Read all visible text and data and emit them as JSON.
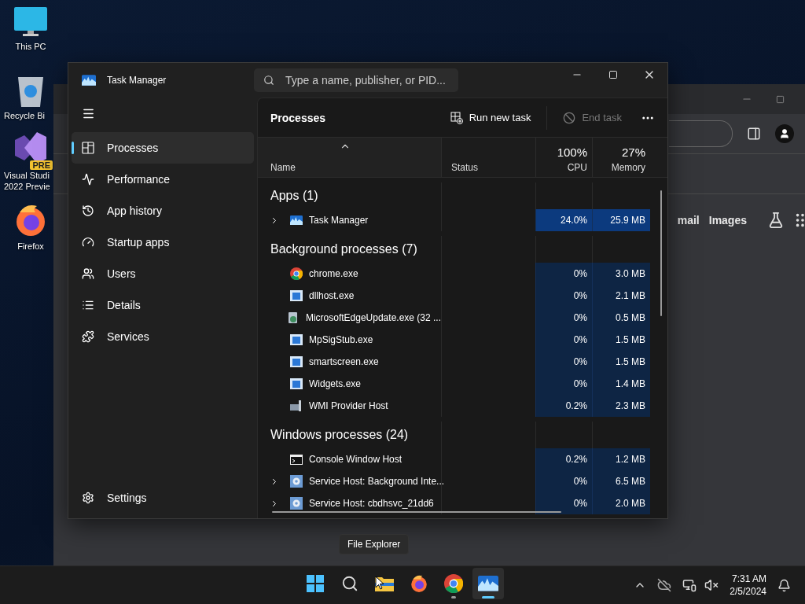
{
  "desktop_icons": [
    {
      "kind": "pc",
      "lines": [
        "This PC"
      ]
    },
    {
      "kind": "bin",
      "lines": [
        "Recycle Bi"
      ]
    },
    {
      "kind": "vs",
      "lines": [
        "Visual Studi",
        "2022 Previe"
      ],
      "badge": "PRE"
    },
    {
      "kind": "firefox",
      "lines": [
        "Firefox"
      ]
    }
  ],
  "browser": {
    "links": [
      "mail",
      "Images"
    ]
  },
  "task_manager": {
    "title": "Task Manager",
    "search": {
      "placeholder": "Type a name, publisher, or PID..."
    },
    "nav": [
      {
        "label": "Processes",
        "kind": "processes",
        "selected": true
      },
      {
        "label": "Performance",
        "kind": "performance",
        "selected": false
      },
      {
        "label": "App history",
        "kind": "history",
        "selected": false
      },
      {
        "label": "Startup apps",
        "kind": "startup",
        "selected": false
      },
      {
        "label": "Users",
        "kind": "users",
        "selected": false
      },
      {
        "label": "Details",
        "kind": "details",
        "selected": false
      },
      {
        "label": "Services",
        "kind": "services",
        "selected": false
      }
    ],
    "settings": "Settings",
    "page_title": "Processes",
    "run_new_task": "Run new task",
    "end_task": {
      "label": "End task",
      "disabled": true
    },
    "columns": [
      {
        "label": "Name"
      },
      {
        "label": "Status"
      },
      {
        "label": "CPU",
        "total": "100%"
      },
      {
        "label": "Memory",
        "total": "27%"
      }
    ],
    "groups": [
      {
        "title": "Apps (1)",
        "rows": [
          {
            "name": "Task Manager",
            "kind": "taskmgr",
            "expandable": true,
            "busy": true,
            "cpu": "24.0%",
            "memory": "25.9 MB"
          }
        ]
      },
      {
        "title": "Background processes (7)",
        "rows": [
          {
            "name": "chrome.exe",
            "kind": "chrome",
            "expandable": false,
            "busy": false,
            "cpu": "0%",
            "memory": "3.0 MB"
          },
          {
            "name": "dllhost.exe",
            "kind": "app",
            "expandable": false,
            "busy": false,
            "cpu": "0%",
            "memory": "2.1 MB"
          },
          {
            "name": "MicrosoftEdgeUpdate.exe (32 ...",
            "kind": "update",
            "expandable": false,
            "busy": false,
            "cpu": "0%",
            "memory": "0.5 MB"
          },
          {
            "name": "MpSigStub.exe",
            "kind": "app",
            "expandable": false,
            "busy": false,
            "cpu": "0%",
            "memory": "1.5 MB"
          },
          {
            "name": "smartscreen.exe",
            "kind": "app",
            "expandable": false,
            "busy": false,
            "cpu": "0%",
            "memory": "1.5 MB"
          },
          {
            "name": "Widgets.exe",
            "kind": "app",
            "expandable": false,
            "busy": false,
            "cpu": "0%",
            "memory": "1.4 MB"
          },
          {
            "name": "WMI Provider Host",
            "kind": "wmi",
            "expandable": false,
            "busy": false,
            "cpu": "0.2%",
            "memory": "2.3 MB"
          }
        ]
      },
      {
        "title": "Windows processes (24)",
        "rows": [
          {
            "name": "Console Window Host",
            "kind": "console",
            "expandable": false,
            "busy": false,
            "cpu": "0.2%",
            "memory": "1.2 MB"
          },
          {
            "name": "Service Host: Background Inte...",
            "kind": "service",
            "expandable": true,
            "busy": false,
            "cpu": "0%",
            "memory": "6.5 MB"
          },
          {
            "name": "Service Host: cbdhsvc_21dd6",
            "kind": "service",
            "expandable": true,
            "busy": false,
            "cpu": "0%",
            "memory": "2.0 MB"
          }
        ]
      }
    ]
  },
  "tooltip": "File Explorer",
  "taskbar": {
    "apps": [
      {
        "kind": "start",
        "running": false,
        "active": false
      },
      {
        "kind": "search",
        "running": false,
        "active": false
      },
      {
        "kind": "explorer",
        "running": false,
        "active": false
      },
      {
        "kind": "firefox",
        "running": false,
        "active": false
      },
      {
        "kind": "chrome",
        "running": true,
        "active": false
      },
      {
        "kind": "taskmgr",
        "running": true,
        "active": true
      }
    ],
    "time": "7:31 AM",
    "date": "2/5/2024"
  }
}
